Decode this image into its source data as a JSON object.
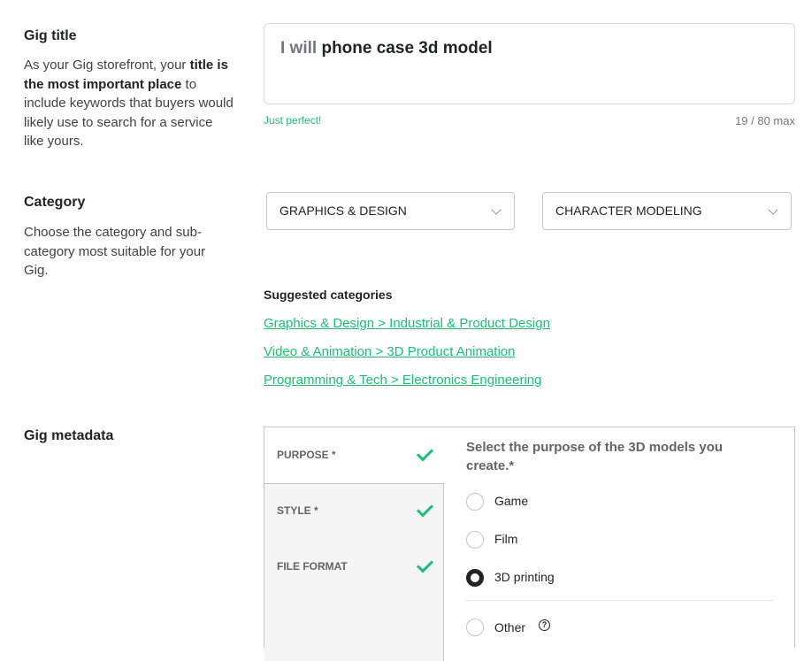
{
  "gig_title": {
    "heading": "Gig title",
    "desc_pre": "As your Gig storefront, your ",
    "desc_bold": "title is the most important place",
    "desc_post": " to include keywords that buyers would likely use to search for a service like yours.",
    "prefix": "I will",
    "value": "phone case 3d model",
    "status": "Just perfect!",
    "counter": "19 / 80 max"
  },
  "category": {
    "heading": "Category",
    "desc": "Choose the category and sub-category most suitable for your Gig.",
    "main_select": "GRAPHICS & DESIGN",
    "sub_select": "CHARACTER MODELING",
    "suggested_title": "Suggested categories",
    "suggested": [
      "Graphics & Design > Industrial & Product Design",
      "Video & Animation > 3D Product Animation",
      "Programming & Tech > Electronics Engineering"
    ]
  },
  "metadata": {
    "heading": "Gig metadata",
    "tabs": [
      {
        "label": "PURPOSE *",
        "complete": true
      },
      {
        "label": "STYLE *",
        "complete": true
      },
      {
        "label": "FILE FORMAT",
        "complete": true
      }
    ],
    "question": "Select the purpose of the 3D models you create.*",
    "options": [
      {
        "label": "Game",
        "selected": false
      },
      {
        "label": "Film",
        "selected": false
      },
      {
        "label": "3D printing",
        "selected": true
      },
      {
        "label": "Other",
        "selected": false
      }
    ],
    "help_glyph": "?"
  },
  "colors": {
    "accent": "#1dbf73",
    "text": "#404145",
    "border": "#c5c6c9"
  }
}
